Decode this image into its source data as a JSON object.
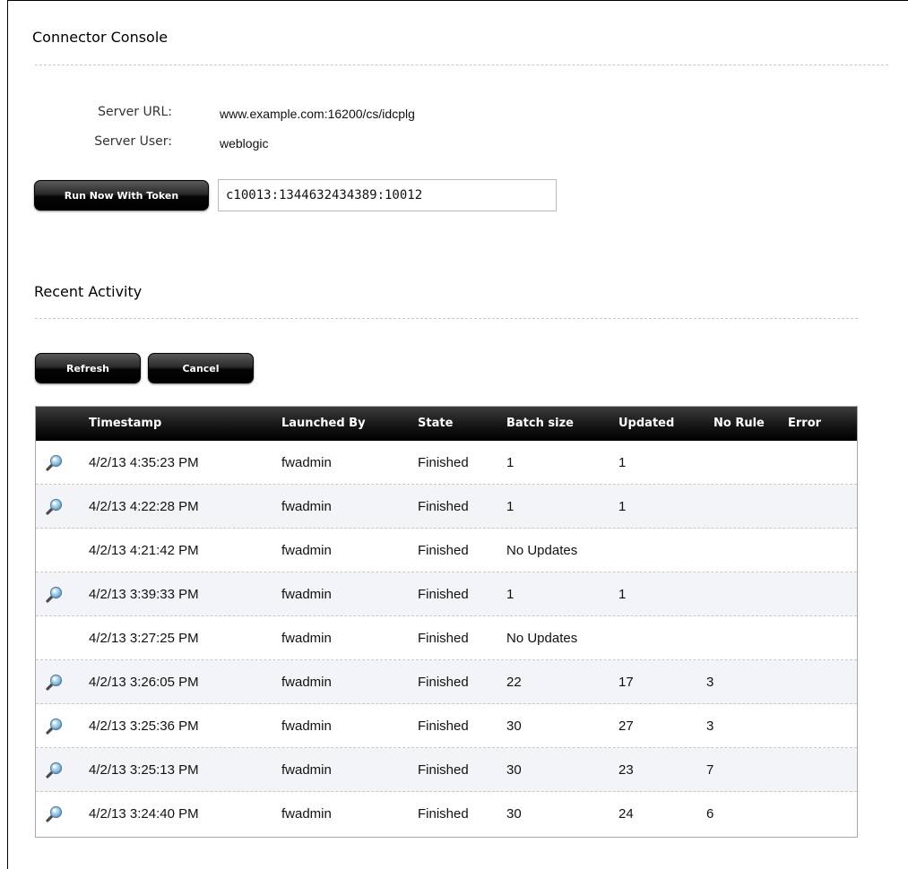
{
  "console": {
    "title": "Connector Console",
    "server_url_label": "Server URL:",
    "server_url": "www.example.com:16200/cs/idcplg",
    "server_user_label": "Server User:",
    "server_user": "weblogic",
    "run_button": "Run Now With Token",
    "token_value": "c10013:1344632434389:10012"
  },
  "activity": {
    "title": "Recent Activity",
    "refresh_button": "Refresh",
    "cancel_button": "Cancel",
    "columns": [
      "Timestamp",
      "Launched By",
      "State",
      "Batch size",
      "Updated",
      "No Rule",
      "Error"
    ],
    "rows": [
      {
        "icon": "magnifier-icon",
        "timestamp": "4/2/13 4:35:23 PM",
        "launched_by": "fwadmin",
        "state": "Finished",
        "batch_size": "1",
        "updated": "1",
        "no_rule": "",
        "error": ""
      },
      {
        "icon": "magnifier-icon",
        "timestamp": "4/2/13 4:22:28 PM",
        "launched_by": "fwadmin",
        "state": "Finished",
        "batch_size": "1",
        "updated": "1",
        "no_rule": "",
        "error": ""
      },
      {
        "icon": "",
        "timestamp": "4/2/13 4:21:42 PM",
        "launched_by": "fwadmin",
        "state": "Finished",
        "batch_size": "No Updates",
        "updated": "",
        "no_rule": "",
        "error": ""
      },
      {
        "icon": "magnifier-icon",
        "timestamp": "4/2/13 3:39:33 PM",
        "launched_by": "fwadmin",
        "state": "Finished",
        "batch_size": "1",
        "updated": "1",
        "no_rule": "",
        "error": ""
      },
      {
        "icon": "",
        "timestamp": "4/2/13 3:27:25 PM",
        "launched_by": "fwadmin",
        "state": "Finished",
        "batch_size": "No Updates",
        "updated": "",
        "no_rule": "",
        "error": ""
      },
      {
        "icon": "magnifier-icon",
        "timestamp": "4/2/13 3:26:05 PM",
        "launched_by": "fwadmin",
        "state": "Finished",
        "batch_size": "22",
        "updated": "17",
        "no_rule": "3",
        "error": ""
      },
      {
        "icon": "magnifier-icon",
        "timestamp": "4/2/13 3:25:36 PM",
        "launched_by": "fwadmin",
        "state": "Finished",
        "batch_size": "30",
        "updated": "27",
        "no_rule": "3",
        "error": ""
      },
      {
        "icon": "magnifier-icon",
        "timestamp": "4/2/13 3:25:13 PM",
        "launched_by": "fwadmin",
        "state": "Finished",
        "batch_size": "30",
        "updated": "23",
        "no_rule": "7",
        "error": ""
      },
      {
        "icon": "magnifier-icon",
        "timestamp": "4/2/13 3:24:40 PM",
        "launched_by": "fwadmin",
        "state": "Finished",
        "batch_size": "30",
        "updated": "24",
        "no_rule": "6",
        "error": ""
      }
    ]
  },
  "colors": {
    "button_bg": "#000000",
    "header_bg": "#1a1a1a",
    "alt_row_bg": "#f3f4f8"
  }
}
